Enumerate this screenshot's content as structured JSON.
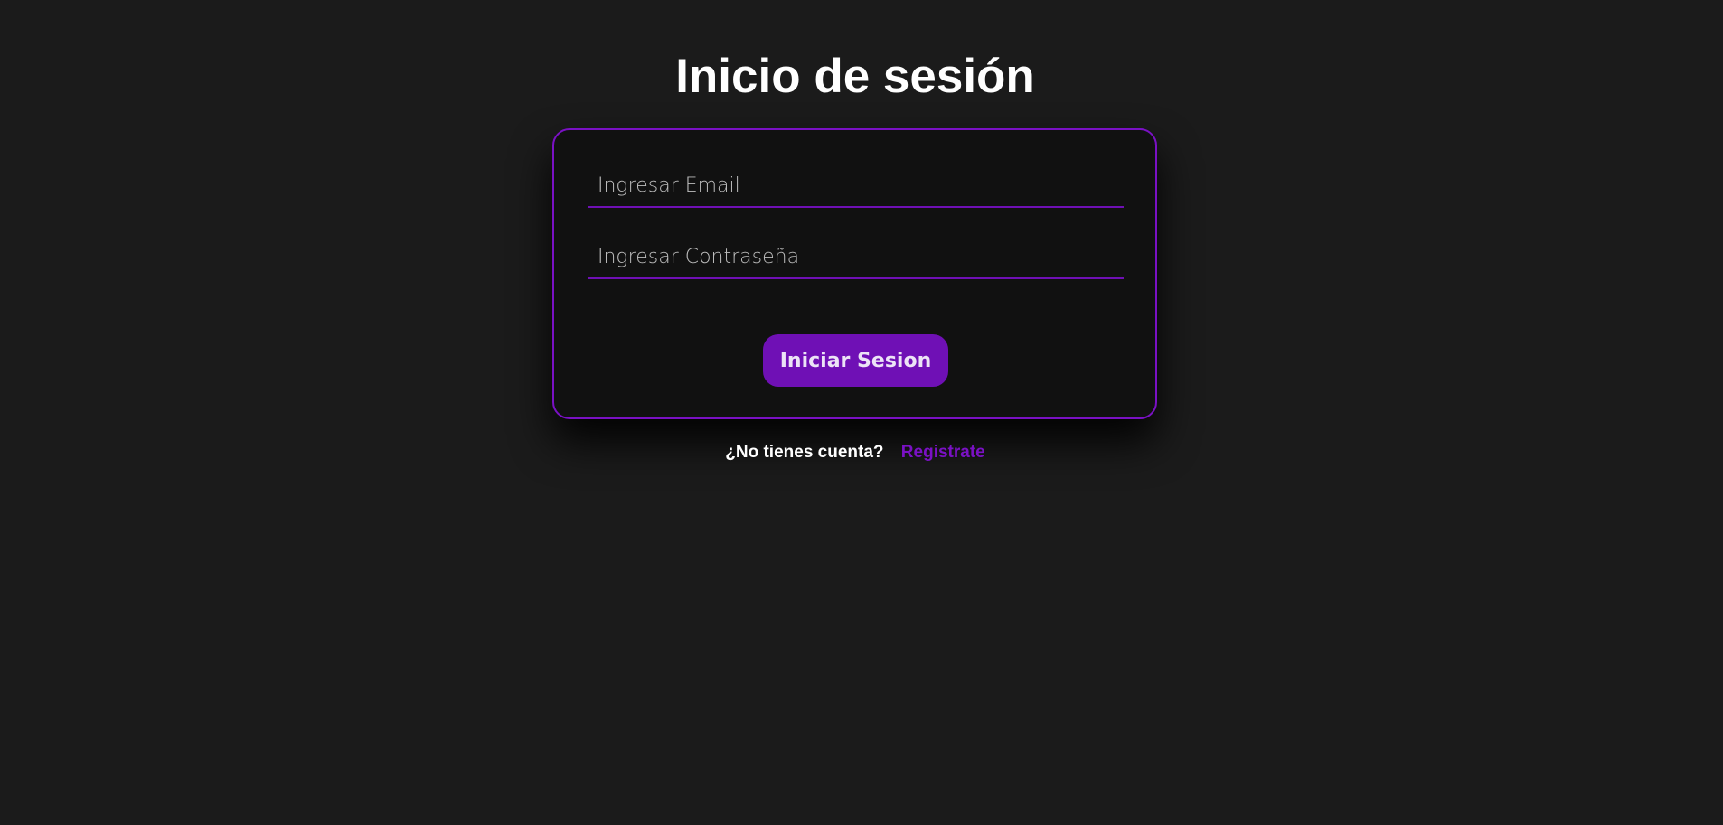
{
  "page": {
    "title": "Inicio de sesión"
  },
  "form": {
    "email_placeholder": "Ingresar Email",
    "email_value": "",
    "password_placeholder": "Ingresar Contraseña",
    "password_value": "",
    "submit_label": "Iniciar Sesion"
  },
  "signup": {
    "question": "¿No tienes cuenta?",
    "link_label": "Registrate"
  },
  "colors": {
    "background": "#1b1b1b",
    "card": "#111111",
    "accent": "#7a11c4",
    "text": "#ffffff"
  }
}
